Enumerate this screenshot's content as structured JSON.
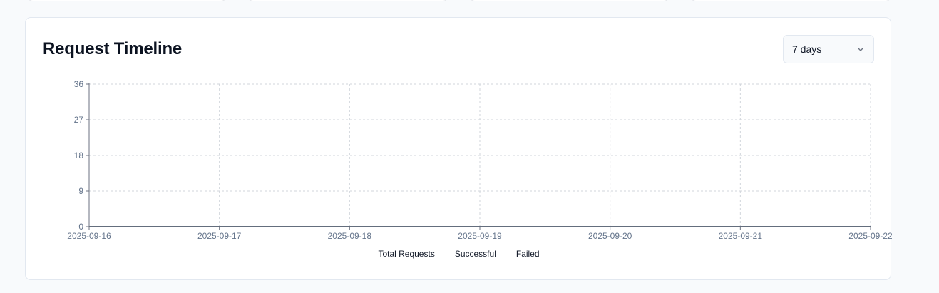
{
  "panel": {
    "title": "Request Timeline",
    "range_select": {
      "value": "7 days"
    }
  },
  "chart_data": {
    "type": "line",
    "title": "",
    "xlabel": "",
    "ylabel": "",
    "x": [
      "2025-09-16",
      "2025-09-17",
      "2025-09-18",
      "2025-09-19",
      "2025-09-20",
      "2025-09-21",
      "2025-09-22"
    ],
    "y_ticks": [
      0,
      9,
      18,
      27,
      36
    ],
    "ylim": [
      0,
      36
    ],
    "grid": true,
    "legend_position": "bottom",
    "series": [
      {
        "name": "Total Requests",
        "values": [
          0,
          0,
          0,
          0,
          0,
          0,
          0
        ]
      },
      {
        "name": "Successful",
        "values": [
          0,
          0,
          0,
          0,
          0,
          0,
          0
        ]
      },
      {
        "name": "Failed",
        "values": [
          0,
          0,
          0,
          0,
          0,
          0,
          0
        ]
      }
    ]
  },
  "colors": {
    "grid": "#d1d5db",
    "axis": "#6b7280",
    "tick_label": "#64748b",
    "series_line": "#475569"
  }
}
